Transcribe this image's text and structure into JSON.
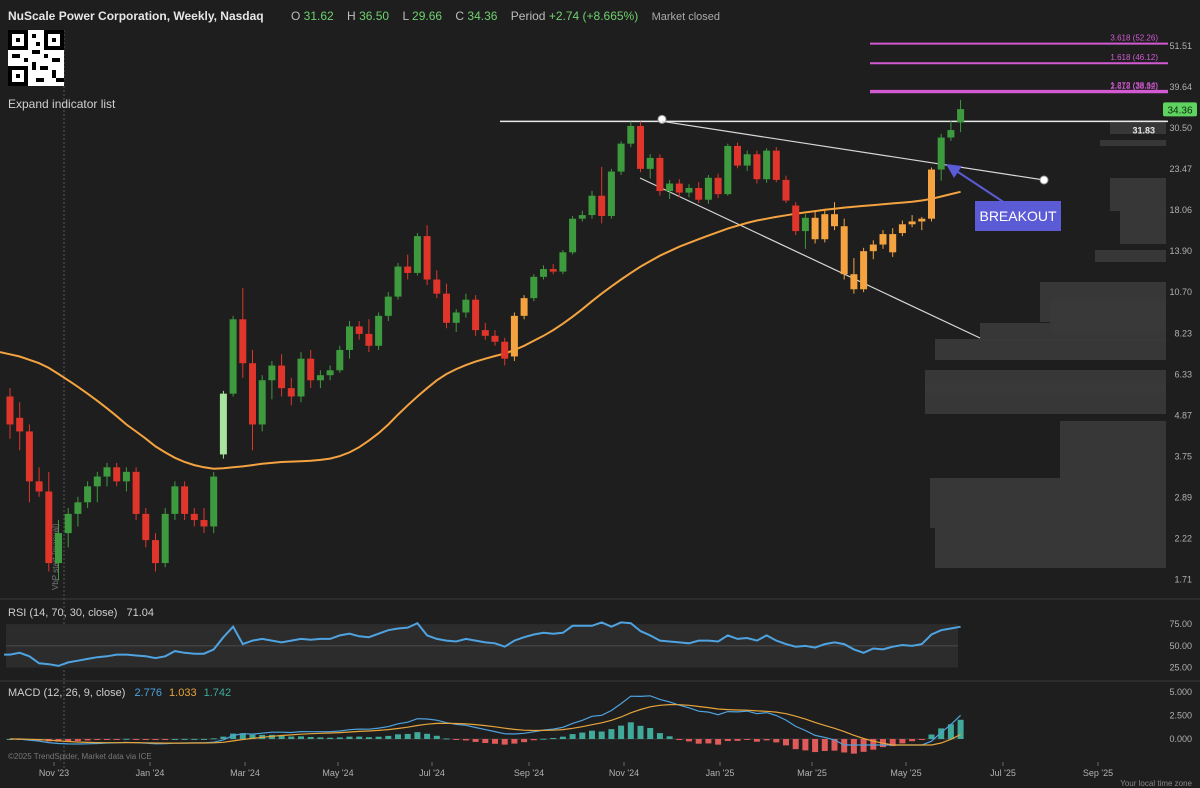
{
  "header": {
    "title": "NuScale Power Corporation, Weekly, Nasdaq",
    "o_label": "O",
    "o_value": "31.62",
    "h_label": "H",
    "h_value": "36.50",
    "l_label": "L",
    "l_value": "29.66",
    "c_label": "C",
    "c_value": "34.36",
    "period_label": "Period",
    "period_value": "+2.74 (+8.665%)",
    "market_status": "Market closed"
  },
  "expand_label": "Expand indicator list",
  "vbp_label": "VbP start (manual)",
  "footer": {
    "credit": "©2025 TrendSpider, Market data via ICE",
    "timezone": "Your local time zone"
  },
  "colors": {
    "up": "#3e9a3e",
    "down": "#e0352b",
    "amber": "#f4a340",
    "ma": "#f4a340",
    "fib": "#d35ad3",
    "rsi": "#4fa3e0",
    "macd": "#4fa3e0",
    "signal": "#e6a43c",
    "hist_up": "#3fa99a",
    "hist_down": "#e05a5a",
    "breakout": "#5b5bd6"
  },
  "chart_data": {
    "type": "candlestick",
    "x_ticks": [
      "Nov '23",
      "Jan '24",
      "Mar '24",
      "May '24",
      "Jul '24",
      "Sep '24",
      "Nov '24",
      "Jan '25",
      "Mar '25",
      "May '25",
      "Jul '25",
      "Sep '25"
    ],
    "y_ticks": [
      51.51,
      39.64,
      30.5,
      23.47,
      18.06,
      13.9,
      10.7,
      8.23,
      6.33,
      4.87,
      3.75,
      2.89,
      2.22,
      1.71
    ],
    "y_scale": "log",
    "ylim": [
      1.6,
      57
    ],
    "last_price": "34.36",
    "resistance_label": "31.83",
    "resistance": 31.83,
    "fib_levels": [
      {
        "label": "3.618 (52.26)",
        "value": 52.26
      },
      {
        "label": "1.618 (46.12)",
        "value": 46.12
      },
      {
        "label": "2.618 (38.32)",
        "value": 38.32
      },
      {
        "label": "1.272 (38.64)",
        "value": 38.64
      }
    ],
    "annotation": "BREAKOUT",
    "candles": [
      [
        5.5,
        5.8,
        4.2,
        4.6
      ],
      [
        4.8,
        5.3,
        3.9,
        4.4
      ],
      [
        4.4,
        4.6,
        2.8,
        3.2
      ],
      [
        3.2,
        3.5,
        2.9,
        3.0
      ],
      [
        3.0,
        3.4,
        1.8,
        1.9
      ],
      [
        1.9,
        2.5,
        1.7,
        2.3
      ],
      [
        2.3,
        2.7,
        2.1,
        2.6
      ],
      [
        2.6,
        2.9,
        2.4,
        2.8
      ],
      [
        2.8,
        3.2,
        2.7,
        3.1
      ],
      [
        3.1,
        3.4,
        2.8,
        3.3
      ],
      [
        3.3,
        3.6,
        3.1,
        3.5
      ],
      [
        3.5,
        3.6,
        3.1,
        3.2
      ],
      [
        3.2,
        3.5,
        3.0,
        3.4
      ],
      [
        3.4,
        3.5,
        2.5,
        2.6
      ],
      [
        2.6,
        2.7,
        2.1,
        2.2
      ],
      [
        2.2,
        2.3,
        1.8,
        1.9
      ],
      [
        1.9,
        2.7,
        1.85,
        2.6
      ],
      [
        2.6,
        3.2,
        2.5,
        3.1
      ],
      [
        3.1,
        3.2,
        2.5,
        2.6
      ],
      [
        2.6,
        2.7,
        2.4,
        2.5
      ],
      [
        2.5,
        2.7,
        2.3,
        2.4
      ],
      [
        2.4,
        3.4,
        2.3,
        3.3
      ],
      [
        3.8,
        5.7,
        3.7,
        5.6
      ],
      [
        5.6,
        9.2,
        5.5,
        9.0
      ],
      [
        9.0,
        11.0,
        6.2,
        6.8
      ],
      [
        6.8,
        7.4,
        3.9,
        4.6
      ],
      [
        4.6,
        6.3,
        4.4,
        6.1
      ],
      [
        6.1,
        6.9,
        5.4,
        6.7
      ],
      [
        6.7,
        7.2,
        5.5,
        5.8
      ],
      [
        5.8,
        6.2,
        5.2,
        5.5
      ],
      [
        5.5,
        7.3,
        5.3,
        7.0
      ],
      [
        7.0,
        7.4,
        5.8,
        6.1
      ],
      [
        6.1,
        6.5,
        5.8,
        6.3
      ],
      [
        6.3,
        6.7,
        6.1,
        6.5
      ],
      [
        6.5,
        7.6,
        6.4,
        7.4
      ],
      [
        7.4,
        8.9,
        7.0,
        8.6
      ],
      [
        8.6,
        8.9,
        7.9,
        8.2
      ],
      [
        8.2,
        9.0,
        7.3,
        7.6
      ],
      [
        7.6,
        9.4,
        7.4,
        9.2
      ],
      [
        9.2,
        10.7,
        8.9,
        10.4
      ],
      [
        10.4,
        12.9,
        10.2,
        12.6
      ],
      [
        12.6,
        13.6,
        11.6,
        12.1
      ],
      [
        12.1,
        15.6,
        11.9,
        15.3
      ],
      [
        15.3,
        16.4,
        11.2,
        11.6
      ],
      [
        11.6,
        12.3,
        10.3,
        10.6
      ],
      [
        10.6,
        11.3,
        8.5,
        8.8
      ],
      [
        8.8,
        9.6,
        8.3,
        9.4
      ],
      [
        9.4,
        10.6,
        9.1,
        10.2
      ],
      [
        10.2,
        10.5,
        8.1,
        8.4
      ],
      [
        8.4,
        8.8,
        7.9,
        8.1
      ],
      [
        8.1,
        8.4,
        7.6,
        7.8
      ],
      [
        7.8,
        8.0,
        6.7,
        7.0
      ],
      [
        7.1,
        9.4,
        6.9,
        9.2
      ],
      [
        9.2,
        10.5,
        9.0,
        10.3
      ],
      [
        10.3,
        12.0,
        10.1,
        11.8
      ],
      [
        11.8,
        12.7,
        11.6,
        12.4
      ],
      [
        12.4,
        12.8,
        12.0,
        12.2
      ],
      [
        12.2,
        14.0,
        12.0,
        13.8
      ],
      [
        13.8,
        17.4,
        13.6,
        17.1
      ],
      [
        17.1,
        18.0,
        16.8,
        17.5
      ],
      [
        17.5,
        20.4,
        17.1,
        19.8
      ],
      [
        19.8,
        23.8,
        16.6,
        17.4
      ],
      [
        17.4,
        23.5,
        17.1,
        23.1
      ],
      [
        23.1,
        28.0,
        22.6,
        27.6
      ],
      [
        27.6,
        31.8,
        27.0,
        30.9
      ],
      [
        30.9,
        31.8,
        23.0,
        23.5
      ],
      [
        23.5,
        25.8,
        22.1,
        25.2
      ],
      [
        25.2,
        25.8,
        19.8,
        20.4
      ],
      [
        20.4,
        21.9,
        19.4,
        21.4
      ],
      [
        21.4,
        22.0,
        19.6,
        20.2
      ],
      [
        20.2,
        21.3,
        19.6,
        20.8
      ],
      [
        20.8,
        21.6,
        18.9,
        19.3
      ],
      [
        19.3,
        22.6,
        18.8,
        22.2
      ],
      [
        22.2,
        22.8,
        19.5,
        20.0
      ],
      [
        20.0,
        27.6,
        19.8,
        27.2
      ],
      [
        27.2,
        27.8,
        23.6,
        24.0
      ],
      [
        24.0,
        26.4,
        23.2,
        25.8
      ],
      [
        25.8,
        26.4,
        21.4,
        22.0
      ],
      [
        22.0,
        26.8,
        21.5,
        26.4
      ],
      [
        26.4,
        27.0,
        21.6,
        21.9
      ],
      [
        21.9,
        22.5,
        18.9,
        19.2
      ],
      [
        18.6,
        19.0,
        15.4,
        15.8
      ],
      [
        15.8,
        17.6,
        14.1,
        17.2
      ],
      [
        17.2,
        17.9,
        14.6,
        15.0
      ],
      [
        15.0,
        18.1,
        14.7,
        17.6
      ],
      [
        17.6,
        19.0,
        15.9,
        16.3
      ],
      [
        16.3,
        17.1,
        11.6,
        12.0
      ],
      [
        12.0,
        13.3,
        10.6,
        10.9
      ],
      [
        10.9,
        14.2,
        10.7,
        13.9
      ],
      [
        13.9,
        14.9,
        13.2,
        14.5
      ],
      [
        14.5,
        15.9,
        14.1,
        15.5
      ],
      [
        15.5,
        16.1,
        13.4,
        13.8
      ],
      [
        15.6,
        16.9,
        15.3,
        16.5
      ],
      [
        16.5,
        17.5,
        16.2,
        16.8
      ],
      [
        16.8,
        17.3,
        15.9,
        17.1
      ],
      [
        17.1,
        23.7,
        16.8,
        23.4
      ],
      [
        23.4,
        29.4,
        21.8,
        28.7
      ],
      [
        28.7,
        31.9,
        28.1,
        30.1
      ],
      [
        31.6,
        36.5,
        29.7,
        34.4
      ]
    ],
    "ma": [
      7.2,
      7.1,
      6.95,
      6.8,
      6.6,
      6.35,
      6.1,
      5.85,
      5.6,
      5.35,
      5.1,
      4.85,
      4.6,
      4.4,
      4.2,
      4.0,
      3.85,
      3.72,
      3.62,
      3.55,
      3.5,
      3.47,
      3.48,
      3.5,
      3.52,
      3.55,
      3.58,
      3.6,
      3.62,
      3.63,
      3.64,
      3.65,
      3.67,
      3.7,
      3.76,
      3.85,
      3.98,
      4.15,
      4.35,
      4.6,
      4.9,
      5.2,
      5.5,
      5.8,
      6.1,
      6.35,
      6.55,
      6.72,
      6.87,
      7.0,
      7.12,
      7.23,
      7.4,
      7.6,
      7.85,
      8.1,
      8.4,
      8.75,
      9.15,
      9.6,
      10.1,
      10.6,
      11.1,
      11.6,
      12.1,
      12.6,
      13.05,
      13.5,
      13.9,
      14.3,
      14.65,
      15.0,
      15.35,
      15.7,
      16.05,
      16.35,
      16.65,
      16.9,
      17.1,
      17.3,
      17.48,
      17.65,
      17.8,
      17.95,
      18.1,
      18.22,
      18.35,
      18.45,
      18.55,
      18.65,
      18.75,
      18.85,
      18.95,
      19.05,
      19.2,
      19.4,
      19.7,
      20.0,
      20.3
    ],
    "rsi": {
      "label": "RSI (14, 70, 30, close)",
      "value": "71.04",
      "ticks": [
        75,
        50,
        25
      ],
      "values": [
        40,
        42,
        38,
        30,
        29,
        27,
        31,
        33,
        35,
        37,
        38,
        40,
        40,
        39,
        38,
        36,
        38,
        44,
        42,
        41,
        41,
        46,
        60,
        72,
        52,
        56,
        58,
        56,
        54,
        56,
        58,
        57,
        58,
        58,
        62,
        64,
        61,
        60,
        64,
        68,
        70,
        71,
        76,
        62,
        58,
        56,
        55,
        58,
        56,
        54,
        53,
        49,
        56,
        60,
        63,
        65,
        64,
        65,
        73,
        73,
        73,
        77,
        72,
        77,
        76,
        67,
        62,
        56,
        55,
        54,
        53,
        56,
        56,
        55,
        62,
        58,
        59,
        56,
        62,
        56,
        52,
        49,
        50,
        48,
        52,
        54,
        52,
        46,
        42,
        47,
        46,
        49,
        51,
        50,
        52,
        63,
        68,
        70,
        72
      ]
    },
    "macd": {
      "label": "MACD (12, 26, 9, close)",
      "values_text": [
        "2.776",
        "1.033",
        "1.742"
      ],
      "ticks": [
        5.0,
        2.5,
        0.0
      ]
    }
  }
}
